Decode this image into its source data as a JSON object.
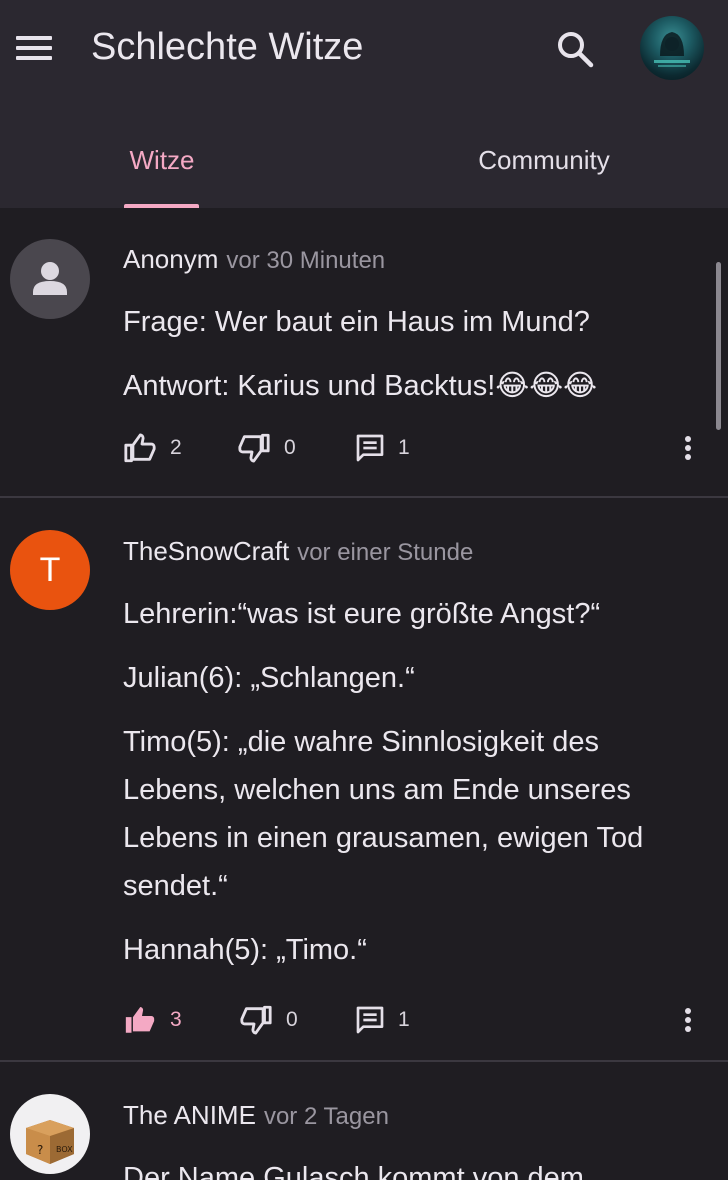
{
  "app": {
    "title": "Schlechte Witze"
  },
  "tabs": [
    {
      "label": "Witze",
      "selected": true
    },
    {
      "label": "Community",
      "selected": false
    }
  ],
  "posts": [
    {
      "author": "Anonym",
      "time": "vor 30 Minuten",
      "avatar": {
        "type": "anonymous-person-icon"
      },
      "lines": [
        "Frage: Wer baut ein Haus im Mund?",
        "Antwort: Karius und Backtus!😂😂😂"
      ],
      "likes": "2",
      "dislikes": "0",
      "comments": "1",
      "liked": false
    },
    {
      "author": "TheSnowCraft",
      "time": "vor einer Stunde",
      "avatar": {
        "type": "letter",
        "letter": "T"
      },
      "lines": [
        "Lehrerin:“was ist eure größte Angst?“",
        "Julian(6): „Schlangen.“",
        "Timo(5): „die wahre Sinnlosigkeit des Lebens, welchen uns am Ende unseres Lebens in einen grausamen, ewigen Tod sendet.“",
        "Hannah(5): „Timo.“"
      ],
      "likes": "3",
      "dislikes": "0",
      "comments": "1",
      "liked": true
    },
    {
      "author": "The ANIME",
      "time": "vor 2 Tagen",
      "avatar": {
        "type": "mystery-box-image"
      },
      "lines": [
        "Der Name Gulasch kommt von dem"
      ]
    }
  ],
  "colors": {
    "accent": "#f4a9c4",
    "topbar": "#2b2830",
    "background": "#1f1d22",
    "avatar_letter_bg": "#e9530f"
  }
}
